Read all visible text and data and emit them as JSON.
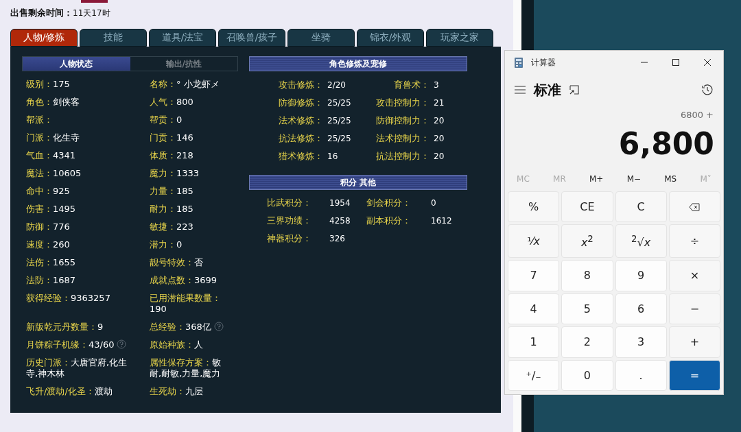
{
  "sale": {
    "label": "出售剩余时间：",
    "value": "11天17时"
  },
  "tabs": [
    {
      "label": "人物/修炼",
      "selected": true
    },
    {
      "label": "技能",
      "selected": false
    },
    {
      "label": "道具/法宝",
      "selected": false
    },
    {
      "label": "召唤兽/孩子",
      "selected": false
    },
    {
      "label": "坐骑",
      "selected": false
    },
    {
      "label": "锦衣/外观",
      "selected": false
    },
    {
      "label": "玩家之家",
      "selected": false
    }
  ],
  "sub_tabs": [
    {
      "label": "人物状态",
      "selected": true
    },
    {
      "label": "输出/抗性",
      "selected": false
    }
  ],
  "stats": [
    {
      "label": "级别：",
      "value": "175",
      "help": false
    },
    {
      "label": "名称：",
      "value": "° 小龙虾メ",
      "help": false
    },
    {
      "label": "角色：",
      "value": "剑侠客",
      "help": false
    },
    {
      "label": "人气：",
      "value": "800",
      "help": false
    },
    {
      "label": "帮派：",
      "help": false
    },
    {
      "label": "帮贡：",
      "value": "0",
      "help": false
    },
    {
      "label": "门派：",
      "value": "化生寺",
      "help": false
    },
    {
      "label": "门贡：",
      "value": "146",
      "help": false
    },
    {
      "label": "气血：",
      "value": "4341",
      "help": false
    },
    {
      "label": "体质：",
      "value": "218",
      "help": false
    },
    {
      "label": "魔法：",
      "value": "10605",
      "help": false
    },
    {
      "label": "魔力：",
      "value": "1333",
      "help": false
    },
    {
      "label": "命中：",
      "value": "925",
      "help": false
    },
    {
      "label": "力量：",
      "value": "185",
      "help": false
    },
    {
      "label": "伤害：",
      "value": "1495",
      "help": false
    },
    {
      "label": "耐力：",
      "value": "185",
      "help": false
    },
    {
      "label": "防御：",
      "value": "776",
      "help": false
    },
    {
      "label": "敏捷：",
      "value": "223",
      "help": false
    },
    {
      "label": "速度：",
      "value": "260",
      "help": false
    },
    {
      "label": "潜力：",
      "value": "0",
      "help": false
    },
    {
      "label": "法伤：",
      "value": "1655",
      "help": false
    },
    {
      "label": "靓号特效：",
      "value": "否",
      "help": false
    },
    {
      "label": "法防：",
      "value": "1687",
      "help": false
    },
    {
      "label": "成就点数：",
      "value": "3699",
      "help": false
    },
    {
      "label": "获得经验：",
      "value": "9363257",
      "help": false
    },
    {
      "label": "已用潜能果数量：",
      "value": "190",
      "help": false
    },
    {
      "label": "新版乾元丹数量：",
      "value": "9",
      "help": false
    },
    {
      "label": "总经验：",
      "value": "368亿",
      "help": true
    },
    {
      "label": "月饼粽子机缘：",
      "value": "43/60",
      "help": true
    },
    {
      "label": "原始种族：",
      "value": "人",
      "help": false
    },
    {
      "label": "历史门派：",
      "value": "大唐官府,化生寺,神木林",
      "help": false
    },
    {
      "label": "属性保存方案：",
      "value": "敏耐,耐敏,力量,魔力",
      "help": false
    },
    {
      "label": "飞升/渡劫/化圣：",
      "value": "渡劫",
      "help": false
    },
    {
      "label": "生死劫：",
      "value": "九层",
      "help": false
    }
  ],
  "cultivation": {
    "title": "角色修炼及宠修",
    "items": [
      {
        "label": "攻击修炼：",
        "value": "2/20"
      },
      {
        "label": "育兽术：",
        "value": "3"
      },
      {
        "label": "防御修炼：",
        "value": "25/25"
      },
      {
        "label": "攻击控制力：",
        "value": "21"
      },
      {
        "label": "法术修炼：",
        "value": "25/25"
      },
      {
        "label": "防御控制力：",
        "value": "20"
      },
      {
        "label": "抗法修炼：",
        "value": "25/25"
      },
      {
        "label": "法术控制力：",
        "value": "20"
      },
      {
        "label": "猎术修炼：",
        "value": "16"
      },
      {
        "label": "抗法控制力：",
        "value": "20"
      }
    ]
  },
  "points": {
    "title": "积分 其他",
    "items": [
      {
        "label": "比武积分：",
        "value": "1954"
      },
      {
        "label": "剑会积分：",
        "value": "0"
      },
      {
        "label": "三界功绩：",
        "value": "4258"
      },
      {
        "label": "副本积分：",
        "value": "1612"
      },
      {
        "label": "神器积分：",
        "value": "326"
      }
    ]
  },
  "calculator": {
    "title": "计算器",
    "mode": "标准",
    "expression": "6800 +",
    "display": "6,800",
    "memory": [
      {
        "label": "MC",
        "disabled": true
      },
      {
        "label": "MR",
        "disabled": true
      },
      {
        "label": "M+",
        "disabled": false
      },
      {
        "label": "M−",
        "disabled": false
      },
      {
        "label": "MS",
        "disabled": false
      },
      {
        "label": "M˅",
        "disabled": true
      }
    ],
    "keys": [
      {
        "kind": "op",
        "label": "%"
      },
      {
        "kind": "op",
        "label": "CE"
      },
      {
        "kind": "op",
        "label": "C"
      },
      {
        "kind": "backspace"
      },
      {
        "kind": "op",
        "label": "¹⁄*x*"
      },
      {
        "kind": "op",
        "label": "*x*$^{2}$"
      },
      {
        "kind": "op",
        "label": "$^{2}$√*x*"
      },
      {
        "kind": "op",
        "label": "÷"
      },
      {
        "kind": "num",
        "label": "7"
      },
      {
        "kind": "num",
        "label": "8"
      },
      {
        "kind": "num",
        "label": "9"
      },
      {
        "kind": "op",
        "label": "×"
      },
      {
        "kind": "num",
        "label": "4"
      },
      {
        "kind": "num",
        "label": "5"
      },
      {
        "kind": "num",
        "label": "6"
      },
      {
        "kind": "op",
        "label": "−"
      },
      {
        "kind": "num",
        "label": "1"
      },
      {
        "kind": "num",
        "label": "2"
      },
      {
        "kind": "num",
        "label": "3"
      },
      {
        "kind": "op",
        "label": "+"
      },
      {
        "kind": "num",
        "label": "⁺∕₋"
      },
      {
        "kind": "num",
        "label": "0"
      },
      {
        "kind": "num",
        "label": "."
      },
      {
        "kind": "equals",
        "label": "="
      }
    ]
  }
}
